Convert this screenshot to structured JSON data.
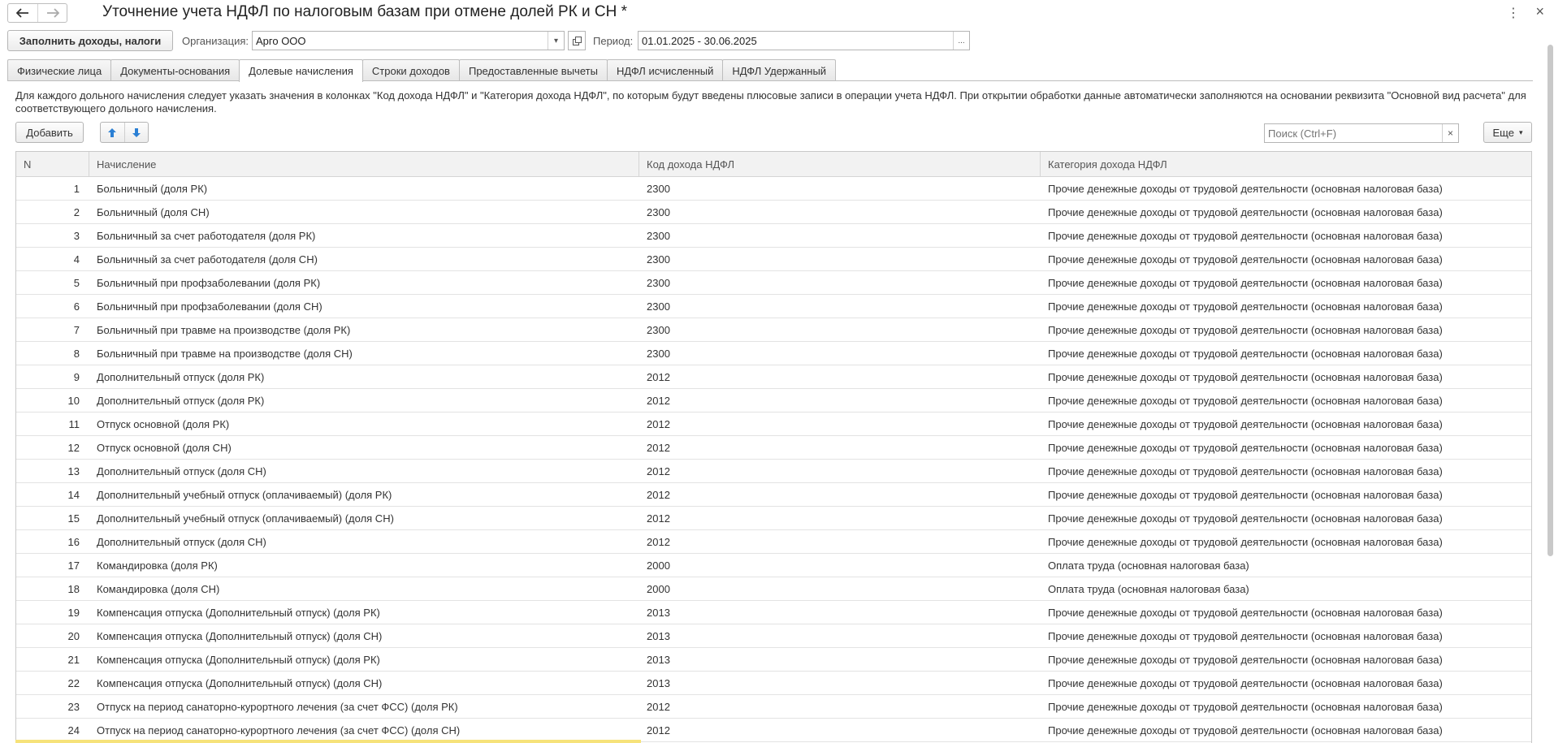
{
  "window": {
    "title": "Уточнение учета НДФЛ по налоговым базам при отмене долей РК и СН *",
    "more_icon": "kebab-menu-icon",
    "close_label": "×"
  },
  "toolbar": {
    "fill_button": "Заполнить доходы, налоги",
    "org_label": "Организация:",
    "org_value": "Арго ООО",
    "period_label": "Период:",
    "period_value": "01.01.2025 - 30.06.2025",
    "period_select": "..."
  },
  "tabs": [
    {
      "label": "Физические лица"
    },
    {
      "label": "Документы-основания"
    },
    {
      "label": "Долевые начисления",
      "active": true
    },
    {
      "label": "Строки доходов"
    },
    {
      "label": "Предоставленные вычеты"
    },
    {
      "label": "НДФЛ исчисленный"
    },
    {
      "label": "НДФЛ Удержанный"
    }
  ],
  "info_text": "Для каждого дольного начисления следует указать значения в колонках \"Код дохода НДФЛ\" и \"Категория дохода НДФЛ\", по которым будут введены плюсовые записи в операции учета НДФЛ. При открытии обработки данные автоматически заполняются на основании реквизита \"Основной вид расчета\" для соответствующего дольного начисления.",
  "actions": {
    "add_button": "Добавить",
    "search_placeholder": "Поиск (Ctrl+F)",
    "search_clear": "×",
    "more_button": "Еще"
  },
  "table": {
    "columns": [
      "N",
      "Начисление",
      "Код дохода НДФЛ",
      "Категория дохода НДФЛ"
    ],
    "rows": [
      [
        "1",
        "Больничный (доля РК)",
        "2300",
        "Прочие денежные доходы от трудовой деятельности (основная налоговая база)"
      ],
      [
        "2",
        "Больничный (доля СН)",
        "2300",
        "Прочие денежные доходы от трудовой деятельности (основная налоговая база)"
      ],
      [
        "3",
        "Больничный за счет работодателя (доля РК)",
        "2300",
        "Прочие денежные доходы от трудовой деятельности (основная налоговая база)"
      ],
      [
        "4",
        "Больничный за счет работодателя (доля СН)",
        "2300",
        "Прочие денежные доходы от трудовой деятельности (основная налоговая база)"
      ],
      [
        "5",
        "Больничный при профзаболевании (доля РК)",
        "2300",
        "Прочие денежные доходы от трудовой деятельности (основная налоговая база)"
      ],
      [
        "6",
        "Больничный при профзаболевании (доля СН)",
        "2300",
        "Прочие денежные доходы от трудовой деятельности (основная налоговая база)"
      ],
      [
        "7",
        "Больничный при травме на производстве (доля РК)",
        "2300",
        "Прочие денежные доходы от трудовой деятельности (основная налоговая база)"
      ],
      [
        "8",
        "Больничный при травме на производстве (доля СН)",
        "2300",
        "Прочие денежные доходы от трудовой деятельности (основная налоговая база)"
      ],
      [
        "9",
        "Дополнительный отпуск (доля РК)",
        "2012",
        "Прочие денежные доходы от трудовой деятельности (основная налоговая база)"
      ],
      [
        "10",
        "Дополнительный отпуск (доля РК)",
        "2012",
        "Прочие денежные доходы от трудовой деятельности (основная налоговая база)"
      ],
      [
        "11",
        "Отпуск основной (доля РК)",
        "2012",
        "Прочие денежные доходы от трудовой деятельности (основная налоговая база)"
      ],
      [
        "12",
        "Отпуск основной (доля СН)",
        "2012",
        "Прочие денежные доходы от трудовой деятельности (основная налоговая база)"
      ],
      [
        "13",
        "Дополнительный отпуск (доля СН)",
        "2012",
        "Прочие денежные доходы от трудовой деятельности (основная налоговая база)"
      ],
      [
        "14",
        "Дополнительный учебный отпуск (оплачиваемый) (доля РК)",
        "2012",
        "Прочие денежные доходы от трудовой деятельности (основная налоговая база)"
      ],
      [
        "15",
        "Дополнительный учебный отпуск (оплачиваемый) (доля СН)",
        "2012",
        "Прочие денежные доходы от трудовой деятельности (основная налоговая база)"
      ],
      [
        "16",
        "Дополнительный отпуск (доля СН)",
        "2012",
        "Прочие денежные доходы от трудовой деятельности (основная налоговая база)"
      ],
      [
        "17",
        "Командировка (доля РК)",
        "2000",
        "Оплата труда (основная налоговая база)"
      ],
      [
        "18",
        "Командировка (доля СН)",
        "2000",
        "Оплата труда (основная налоговая база)"
      ],
      [
        "19",
        "Компенсация отпуска (Дополнительный отпуск) (доля РК)",
        "2013",
        "Прочие денежные доходы от трудовой деятельности (основная налоговая база)"
      ],
      [
        "20",
        "Компенсация отпуска (Дополнительный отпуск) (доля СН)",
        "2013",
        "Прочие денежные доходы от трудовой деятельности (основная налоговая база)"
      ],
      [
        "21",
        "Компенсация отпуска (Дополнительный отпуск) (доля РК)",
        "2013",
        "Прочие денежные доходы от трудовой деятельности (основная налоговая база)"
      ],
      [
        "22",
        "Компенсация отпуска (Дополнительный отпуск) (доля СН)",
        "2013",
        "Прочие денежные доходы от трудовой деятельности (основная налоговая база)"
      ],
      [
        "23",
        "Отпуск на период санаторно-курортного лечения (за счет ФСС) (доля РК)",
        "2012",
        "Прочие денежные доходы от трудовой деятельности (основная налоговая база)"
      ],
      [
        "24",
        "Отпуск на период санаторно-курортного лечения (за счет ФСС) (доля СН)",
        "2012",
        "Прочие денежные доходы от трудовой деятельности (основная налоговая база)"
      ]
    ]
  },
  "colors": {
    "arrow_blue": "#2a7fd4",
    "row_border": "#e3e3e3",
    "header_bg": "#f2f2f2"
  }
}
